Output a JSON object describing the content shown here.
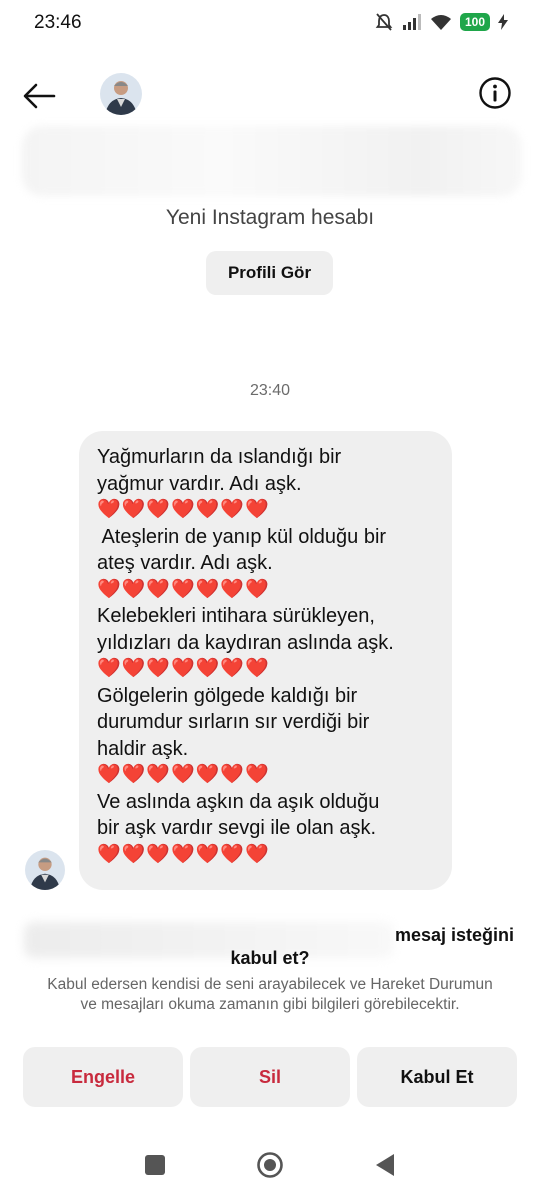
{
  "status_bar": {
    "time": "23:46",
    "battery": "100",
    "icons": [
      "mute-bell-icon",
      "signal-icon",
      "wifi-icon",
      "battery-icon",
      "charging-icon"
    ]
  },
  "header": {
    "back_icon": "back-arrow-icon",
    "info_icon": "info-icon"
  },
  "profile": {
    "subtitle": "Yeni Instagram hesabı",
    "view_profile_label": "Profili Gör"
  },
  "conversation": {
    "timestamp": "23:40",
    "message_lines": [
      {
        "text": "Yağmurların da ıslandığı bir",
        "hearts": false
      },
      {
        "text": "yağmur vardır. Adı aşk.",
        "hearts": false
      },
      {
        "text": "❤️❤️❤️❤️❤️❤️❤️",
        "hearts": true
      },
      {
        "text": " Ateşlerin de yanıp kül olduğu bir",
        "hearts": false
      },
      {
        "text": "ateş vardır. Adı aşk.",
        "hearts": false
      },
      {
        "text": "❤️❤️❤️❤️❤️❤️❤️",
        "hearts": true
      },
      {
        "text": "Kelebekleri intihara sürükleyen,",
        "hearts": false
      },
      {
        "text": "yıldızları da kaydıran aslında aşk.",
        "hearts": false
      },
      {
        "text": "❤️❤️❤️❤️❤️❤️❤️",
        "hearts": true
      },
      {
        "text": "Gölgelerin gölgede kaldığı bir",
        "hearts": false
      },
      {
        "text": "durumdur sırların sır verdiği bir",
        "hearts": false
      },
      {
        "text": "haldir aşk.",
        "hearts": false
      },
      {
        "text": "❤️❤️❤️❤️❤️❤️❤️",
        "hearts": true
      },
      {
        "text": "Ve aslında aşkın da aşık olduğu",
        "hearts": false
      },
      {
        "text": "bir aşk vardır sevgi ile olan aşk.",
        "hearts": false
      },
      {
        "text": "❤️❤️❤️❤️❤️❤️❤️",
        "hearts": true
      }
    ]
  },
  "request": {
    "title_part1": "mesaj isteğini",
    "title_part2": "kabul et?",
    "description": "Kabul edersen kendisi de seni arayabilecek ve Hareket Durumun ve mesajları okuma zamanın gibi bilgileri görebilecektir.",
    "block_label": "Engelle",
    "delete_label": "Sil",
    "accept_label": "Kabul Et"
  },
  "colors": {
    "danger": "#c82a3d",
    "bubble": "#efefef",
    "battery": "#1fa64a"
  },
  "nav_bar": {
    "icons": [
      "recents-square-icon",
      "home-circle-icon",
      "back-triangle-icon"
    ]
  }
}
